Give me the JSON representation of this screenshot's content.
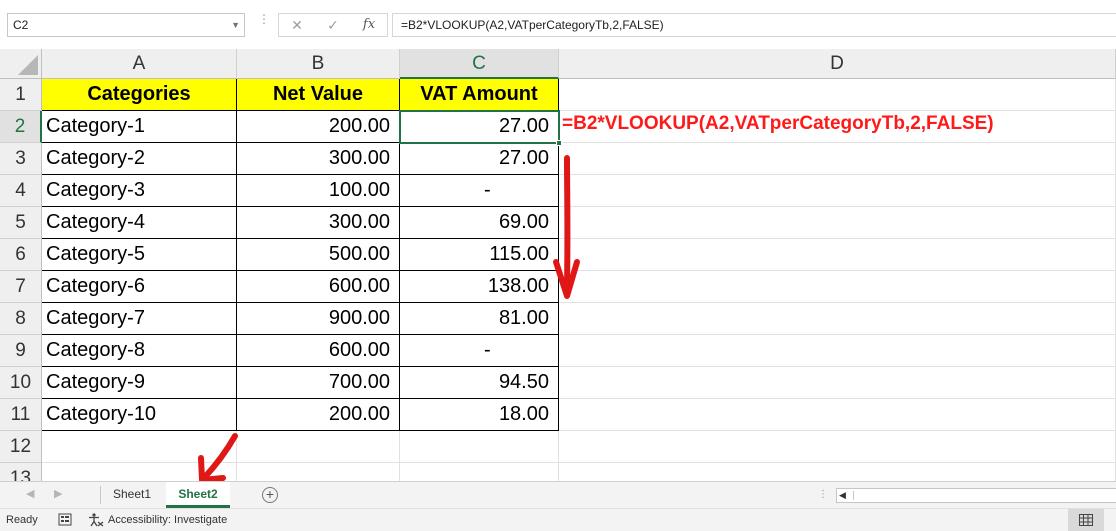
{
  "formula_bar": {
    "name_box": "C2",
    "cancel_symbol": "✕",
    "enter_symbol": "✓",
    "fx_label": "fx",
    "formula": "=B2*VLOOKUP(A2,VATperCategoryTb,2,FALSE)"
  },
  "columns": [
    "A",
    "B",
    "C",
    "D"
  ],
  "selected_column": "C",
  "row_numbers": [
    "1",
    "2",
    "3",
    "4",
    "5",
    "6",
    "7",
    "8",
    "9",
    "10",
    "11",
    "12",
    "13"
  ],
  "selected_row": "2",
  "table": {
    "headers": [
      "Categories",
      "Net Value",
      "VAT Amount"
    ],
    "rows": [
      [
        "Category-1",
        "200.00",
        "27.00"
      ],
      [
        "Category-2",
        "300.00",
        "27.00"
      ],
      [
        "Category-3",
        "100.00",
        "-"
      ],
      [
        "Category-4",
        "300.00",
        "69.00"
      ],
      [
        "Category-5",
        "500.00",
        "115.00"
      ],
      [
        "Category-6",
        "600.00",
        "138.00"
      ],
      [
        "Category-7",
        "900.00",
        "81.00"
      ],
      [
        "Category-8",
        "600.00",
        "-"
      ],
      [
        "Category-9",
        "700.00",
        "94.50"
      ],
      [
        "Category-10",
        "200.00",
        "18.00"
      ]
    ]
  },
  "annotation": {
    "formula_text": "=B2*VLOOKUP(A2,VATperCategoryTb,2,FALSE)",
    "color": "#ff1a1a"
  },
  "sheet_tabs": {
    "tabs": [
      "Sheet1",
      "Sheet2"
    ],
    "active": "Sheet2",
    "add_symbol": "+"
  },
  "status_bar": {
    "ready": "Ready",
    "accessibility": "Accessibility: Investigate"
  },
  "colors": {
    "excel_green": "#217346",
    "header_fill": "#ffff00"
  }
}
